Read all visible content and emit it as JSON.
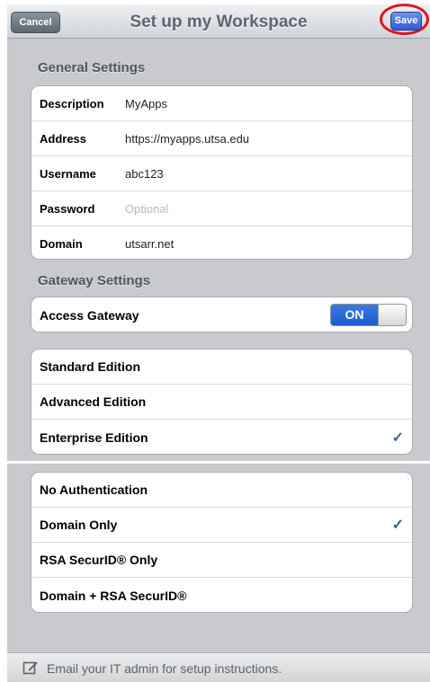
{
  "nav": {
    "title": "Set up my Workspace",
    "cancel_label": "Cancel",
    "save_label": "Save"
  },
  "general": {
    "heading": "General Settings",
    "fields": [
      {
        "label": "Description",
        "value": "MyApps",
        "placeholder": ""
      },
      {
        "label": "Address",
        "value": "https://myapps.utsa.edu",
        "placeholder": ""
      },
      {
        "label": "Username",
        "value": "abc123",
        "placeholder": ""
      },
      {
        "label": "Password",
        "value": "",
        "placeholder": "Optional"
      },
      {
        "label": "Domain",
        "value": "utsarr.net",
        "placeholder": ""
      }
    ]
  },
  "gateway": {
    "heading": "Gateway Settings",
    "access_label": "Access Gateway",
    "toggle_state": "ON"
  },
  "editions": {
    "items": [
      {
        "label": "Standard Edition",
        "checked": false
      },
      {
        "label": "Advanced Edition",
        "checked": false
      },
      {
        "label": "Enterprise Edition",
        "checked": true
      }
    ]
  },
  "auth": {
    "items": [
      {
        "label": "No Authentication",
        "checked": false
      },
      {
        "label": "Domain Only",
        "checked": true
      },
      {
        "label": "RSA SecurID® Only",
        "checked": false
      },
      {
        "label": "Domain + RSA SecurID®",
        "checked": false
      }
    ]
  },
  "footer": {
    "text": "Email your IT admin for setup instructions.",
    "icon": "compose-icon"
  },
  "colors": {
    "accent": "#2e5bd6",
    "highlight_ring": "#e0141c",
    "check": "#3a5f9c"
  },
  "checkmark_glyph": "✓"
}
